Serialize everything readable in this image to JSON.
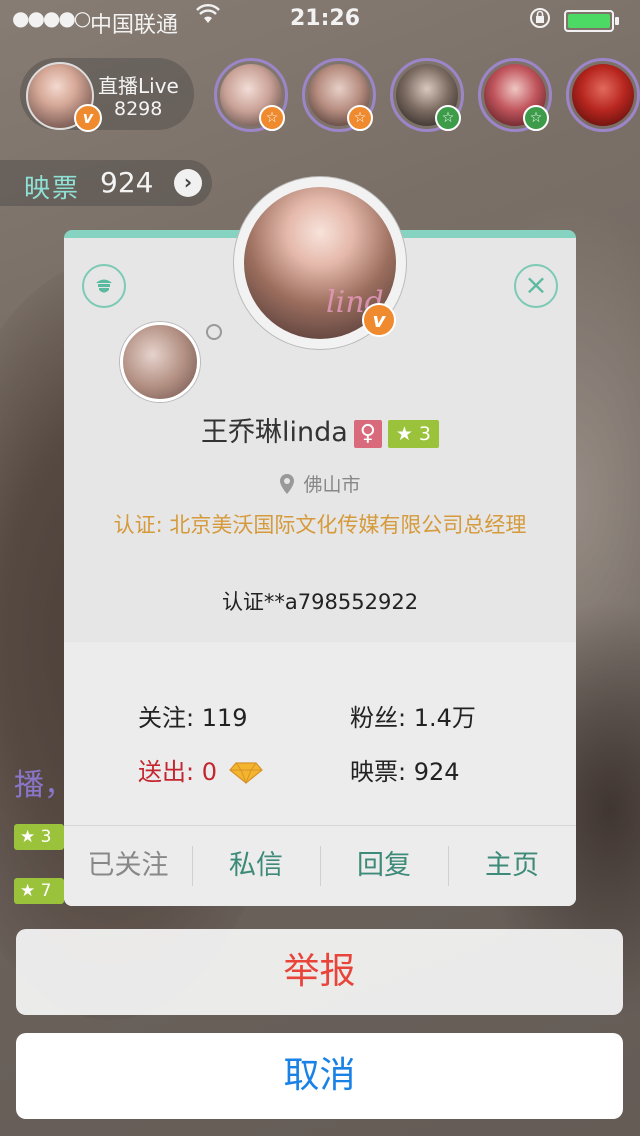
{
  "status_bar": {
    "signal": "●●●●○",
    "carrier": "中国联通",
    "time": "21:26",
    "battery_color": "#4cd964"
  },
  "header": {
    "host_title": "直播Live",
    "host_count": "8298",
    "host_badge": "v",
    "viewer_badges": [
      "☆",
      "☆",
      "☆",
      "☆",
      ""
    ]
  },
  "ticket": {
    "label": "映票",
    "value": "924",
    "arrow": "›"
  },
  "chat": {
    "fragment": "播，",
    "level_tags": [
      "★ 3",
      "★ 7"
    ]
  },
  "profile": {
    "name": "王乔琳linda",
    "gender_symbol": "♀",
    "level": "★ 3",
    "location": "佛山市",
    "certification": "认证: 北京美沃国际文化传媒有限公司总经理",
    "cert_id": "认证**a798552922",
    "avatar_badge": "v",
    "watermark": "linda",
    "stats": {
      "follow_label": "关注:",
      "follow_value": "119",
      "fans_label": "粉丝:",
      "fans_value": "1.4万",
      "sent_label": "送出:",
      "sent_value": "0",
      "tickets_label": "映票:",
      "tickets_value": "924"
    },
    "actions": [
      "已关注",
      "私信",
      "回复",
      "主页"
    ],
    "close_symbol": "×"
  },
  "sheet": {
    "report": "举报",
    "cancel": "取消"
  },
  "colors": {
    "accent": "#87d3c2",
    "report_red": "#e8443a",
    "cancel_blue": "#1a82e6",
    "cert_orange": "#d59a3b",
    "sent_red": "#c3262e",
    "level_green": "#9ac23b"
  }
}
